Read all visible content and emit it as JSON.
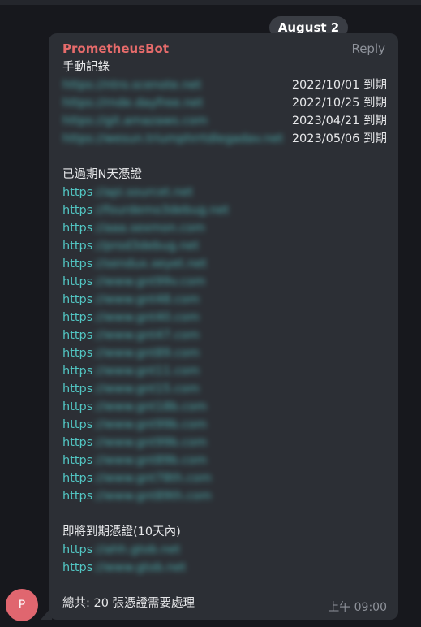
{
  "date_chip": "August 2",
  "message": {
    "sender": "PrometheusBot",
    "reply_label": "Reply",
    "heading_manual": "手動記錄",
    "manual_records": [
      {
        "url": "https://ntro.scenote.net",
        "expiry": "2022/10/01 到期"
      },
      {
        "url": "https://rnde.dayfree.net",
        "expiry": "2022/10/25 到期"
      },
      {
        "url": "https://git.amazaws.com",
        "expiry": "2023/04/21 到期"
      },
      {
        "url": "https://wesun.triumphrrtdlegadav.net",
        "expiry": "2023/05/06 到期"
      }
    ],
    "heading_expired": "已過期N天憑證",
    "expired_prefix": "https",
    "expired_links": [
      "://api.sourcet.net",
      "://fourdemo3debug.net",
      "://aaa.sexmon.com",
      "://prod3debug.net",
      "://sendux.xeyet.net",
      "://www.gnt99v.com",
      "://www.gnt48.com",
      "://www.gnt40.com",
      "://www.gnt47.com",
      "://www.gnt89.com",
      "://www.gnt11.com",
      "://www.gnt15.com",
      "://www.gnt18b.com",
      "://www.gnt99b.com",
      "://www.gnt99b.com",
      "://www.gnt89b.com",
      "://www.gnt78th.com",
      "://www.gnt89th.com"
    ],
    "heading_soon": "即將到期憑證(10天內)",
    "soon_links": [
      "://ahh.gtob.net",
      "://www.gtob.net"
    ],
    "total": "總共: 20 張憑證需要處理",
    "time": "上午 09:00"
  },
  "avatar_letter": "P"
}
